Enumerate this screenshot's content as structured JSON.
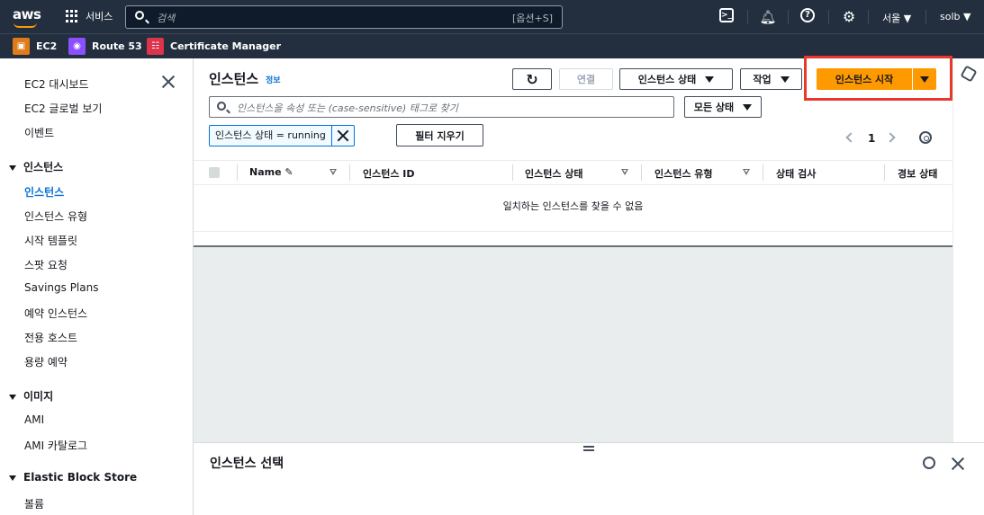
{
  "topbar": {
    "logo": "aws",
    "services_label": "서비스",
    "search_placeholder": "검색",
    "search_shortcut": "[옵션+S]",
    "region": "서울 ▼",
    "user": "solb ▼"
  },
  "favorites": [
    {
      "label": "EC2",
      "color": "#e07b1a",
      "icon": "ec2-icon"
    },
    {
      "label": "Route 53",
      "color": "#8c4fff",
      "icon": "route53-icon"
    },
    {
      "label": "Certificate Manager",
      "color": "#dd344c",
      "icon": "certificate-icon"
    }
  ],
  "sidebar": {
    "items_top": [
      "EC2 대시보드",
      "EC2 글로벌 보기",
      "이벤트"
    ],
    "section_instances": "인스턴스",
    "instances_items": [
      "인스턴스",
      "인스턴스 유형",
      "시작 템플릿",
      "스팟 요청",
      "Savings Plans",
      "예약 인스턴스",
      "전용 호스트",
      "용량 예약"
    ],
    "section_images": "이미지",
    "images_items": [
      "AMI",
      "AMI 카탈로그"
    ],
    "section_ebs": "Elastic Block Store",
    "ebs_items": [
      "볼륨"
    ]
  },
  "main": {
    "title": "인스턴스",
    "info": "정보",
    "connect": "연결",
    "instance_state": "인스턴스 상태",
    "actions": "작업",
    "launch": "인스턴스 시작",
    "filter_placeholder": "인스턴스을 속성 또는 (case-sensitive) 태그로 찾기",
    "all_states": "모든 상태",
    "filter_token": "인스턴스 상태 = running",
    "clear_filters": "필터 지우기",
    "page": "1",
    "columns": [
      "Name",
      "인스턴스 ID",
      "인스턴스 상태",
      "인스턴스 유형",
      "상태 검사",
      "경보 상태"
    ],
    "empty_message": "일치하는 인스턴스를 찾을 수 없음"
  },
  "bottom_panel": {
    "title": "인스턴스 선택"
  }
}
